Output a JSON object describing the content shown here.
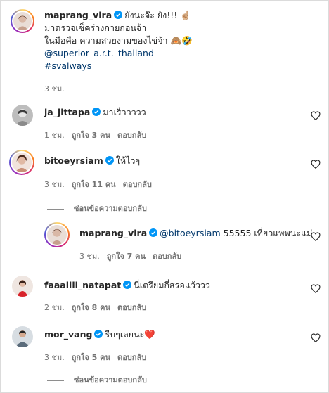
{
  "post": {
    "username": "maprang_vira",
    "caption_line1": "ยังนะจ๊ะ ยัง!!! ☝🏼",
    "caption_line2": "มาตรวจเช็คร่างกายก่อนจ้า",
    "caption_line3": "ในมือคือ ความสวยงามของไข่จ้า 🙈🤣",
    "mention": "@superior_a.r.t._thailand",
    "hashtag": "#svalways",
    "time": "3 ชม."
  },
  "comments": [
    {
      "username": "ja_jittapa",
      "text": "มาเร็ววววว",
      "time": "1 ชม.",
      "likes": "ถูกใจ 3 คน",
      "reply": "ตอบกลับ"
    },
    {
      "username": "bitoeyrsiam",
      "text": "ให้ไวๆ",
      "time": "3 ชม.",
      "likes": "ถูกใจ 11 คน",
      "reply": "ตอบกลับ",
      "hide_replies": "ซ่อนข้อความตอบกลับ",
      "reply_item": {
        "username": "maprang_vira",
        "mention": "@bitoeyrsiam",
        "text": "55555 เที่ยวแพพนะแม่",
        "time": "3 ชม.",
        "likes": "ถูกใจ 7 คน",
        "reply": "ตอบกลับ"
      }
    },
    {
      "username": "faaaiiii_natapat",
      "text": "นี่เตรียมกี่สรอแว้ววว",
      "time": "2 ชม.",
      "likes": "ถูกใจ 8 คน",
      "reply": "ตอบกลับ"
    },
    {
      "username": "mor_vang",
      "text": "รีบๆเลยนะ❤️",
      "time": "3 ชม.",
      "likes": "ถูกใจ 5 คน",
      "reply": "ตอบกลับ",
      "hide_replies": "ซ่อนข้อความตอบกลับ"
    }
  ],
  "colors": {
    "verified": "#0095f6",
    "link": "#00376b",
    "meta": "#737373"
  },
  "icons": {
    "verified": "verified-badge-icon",
    "like": "heart-outline-icon"
  }
}
